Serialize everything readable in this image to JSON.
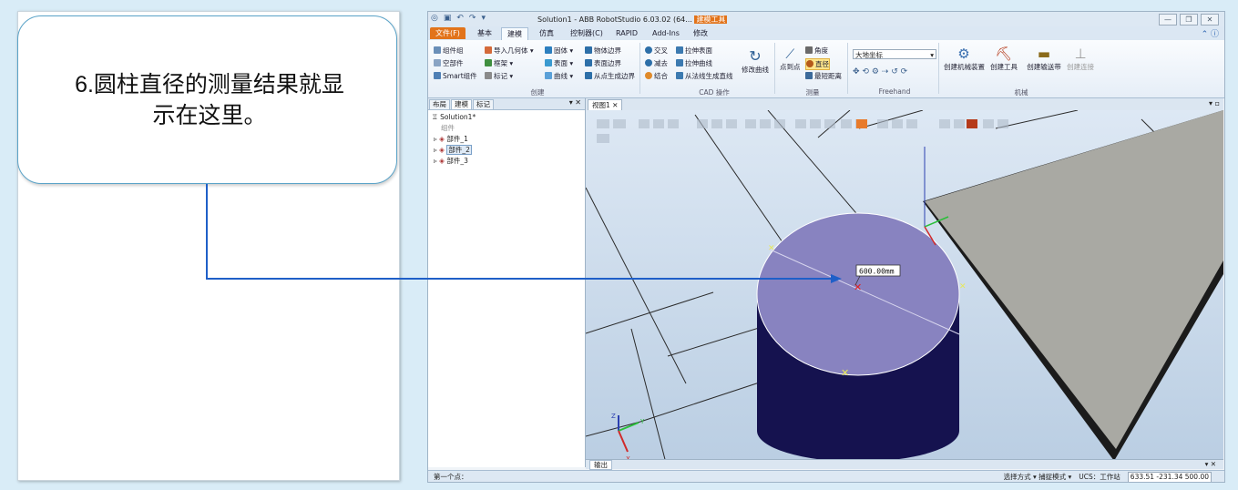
{
  "callout": {
    "step_number": "6.",
    "text_line1": "圆柱直径的测量结果就显",
    "text_line2": "示在这里。"
  },
  "app": {
    "title": "Solution1 - ABB RobotStudio 6.03.02 (64...",
    "title_badge": "建模工具",
    "window_buttons": [
      "—",
      "❐",
      "✕"
    ],
    "tabs": [
      {
        "label": "文件(F)"
      },
      {
        "label": "基本"
      },
      {
        "label": "建模"
      },
      {
        "label": "仿真"
      },
      {
        "label": "控制器(C)"
      },
      {
        "label": "RAPID"
      },
      {
        "label": "Add-Ins"
      },
      {
        "label": "修改"
      }
    ],
    "ribbon": {
      "create": {
        "group_label": "创建",
        "items": [
          "组件组",
          "空部件",
          "Smart组件",
          "导入几何体",
          "框架",
          "标记",
          "固体",
          "表面",
          "曲线",
          "物体边界",
          "表面边界",
          "从点生成边界"
        ]
      },
      "cad": {
        "group_label": "CAD 操作",
        "items": [
          "交叉",
          "减去",
          "结合",
          "拉伸表面",
          "拉伸曲线",
          "从法线生成直线",
          "修改曲线"
        ]
      },
      "measure": {
        "group_label": "测量",
        "items": [
          "点到点",
          "角度",
          "直径",
          "最短距离"
        ]
      },
      "freehand": {
        "group_label": "Freehand",
        "frame_select": "大地坐标"
      },
      "mechanism": {
        "group_label": "机械",
        "items": [
          "创建机械装置",
          "创建工具",
          "创建输送带",
          "创建连接"
        ]
      }
    },
    "left_panel": {
      "tabs": [
        "布局",
        "建模",
        "标记"
      ],
      "tree": {
        "root": "Solution1*",
        "group": "组件",
        "parts": [
          "部件_1",
          "部件_2",
          "部件_3"
        ]
      }
    },
    "view_tab": "视图1",
    "measurement_label": "600.00mm",
    "axes": {
      "x": "X",
      "y": "Y",
      "z": "Z"
    },
    "output_tab": "输出",
    "status": {
      "left": "第一个点：",
      "mode": "选择方式 ▾ 捕捉模式 ▾",
      "ucs": "UCS：工作站",
      "coords": "633.51 -231.34 500.00"
    }
  }
}
